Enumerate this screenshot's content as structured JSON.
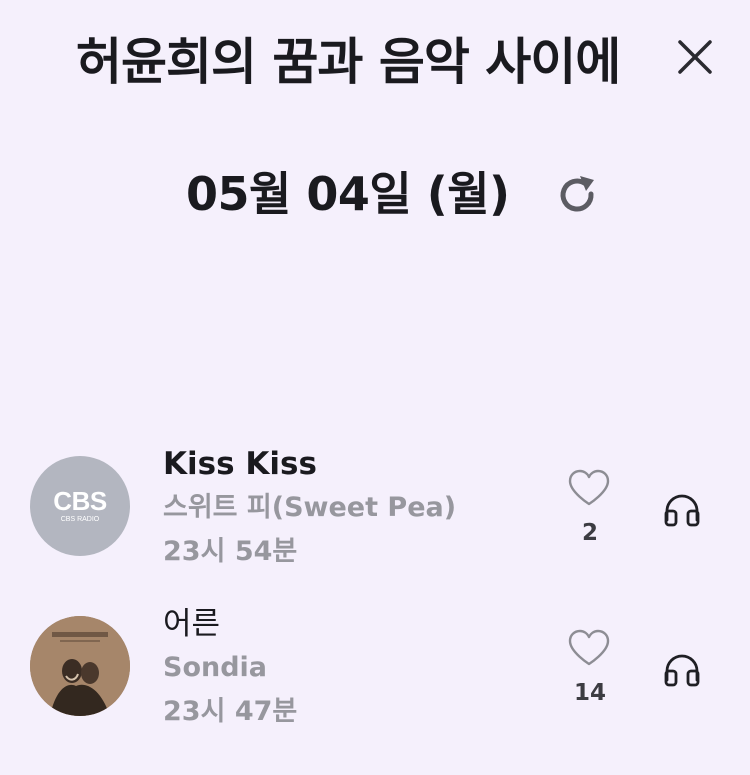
{
  "header": {
    "program_title": "허윤희의 꿈과 음악 사이에",
    "close_icon": "close-icon"
  },
  "date_bar": {
    "date": "05월 04일 (월)",
    "refresh_icon": "refresh-icon"
  },
  "tracks": [
    {
      "title": "Kiss Kiss",
      "artist": "스위트 피(Sweet Pea)",
      "time": "23시 54분",
      "likes": "2",
      "thumbnail": {
        "logo": "CBS",
        "sub": "CBS RADIO"
      },
      "like_icon": "heart-icon",
      "listen_icon": "headphones-icon"
    },
    {
      "title": "어른",
      "artist": "Sondia",
      "time": "23시 47분",
      "likes": "14",
      "like_icon": "heart-icon",
      "listen_icon": "headphones-icon"
    }
  ],
  "colors": {
    "background": "#f5f0fc",
    "text": "#1a1a1f",
    "muted_text": "#97979e",
    "cbs_avatar": "#b3b6c0"
  }
}
